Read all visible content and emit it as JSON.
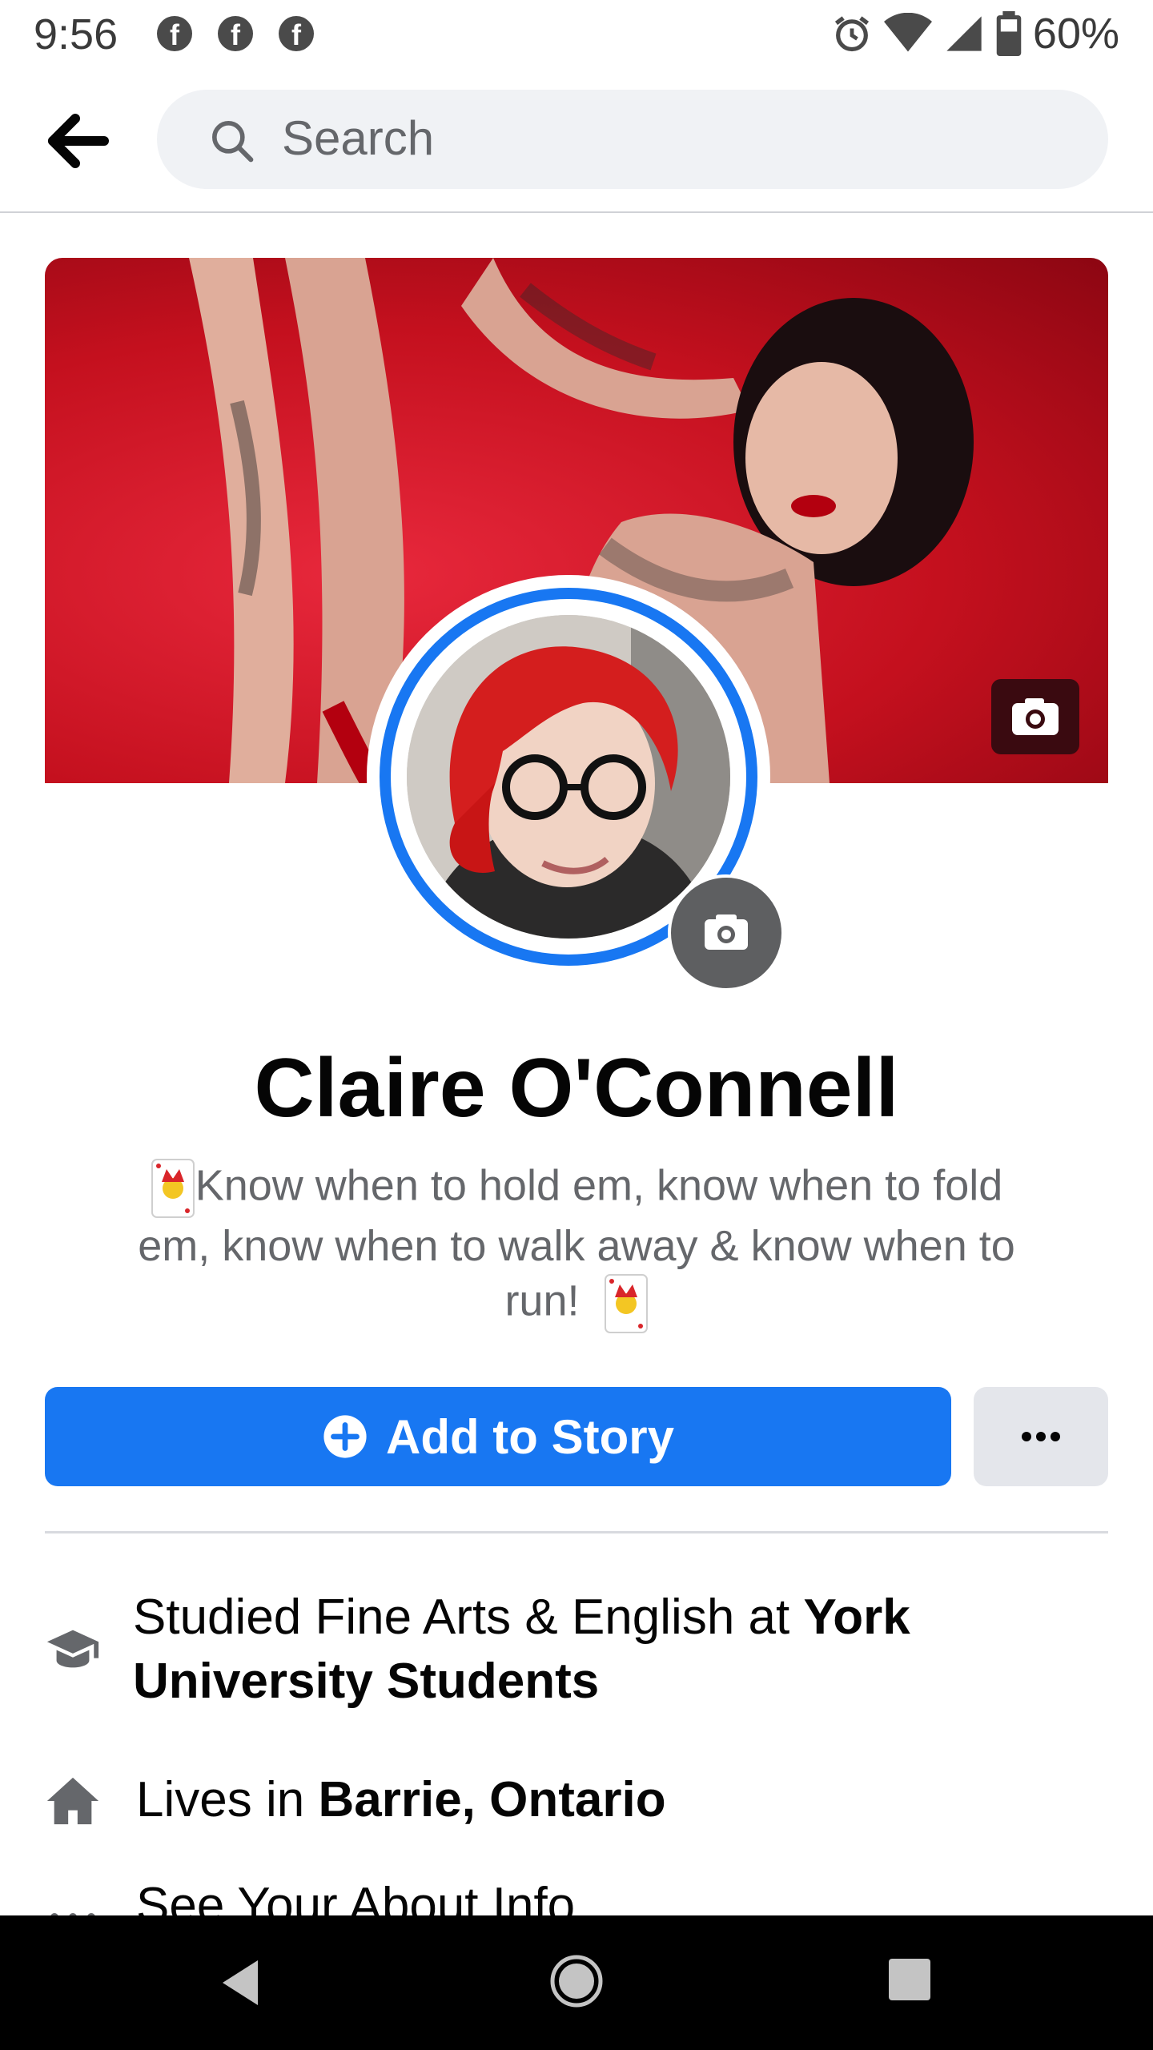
{
  "status_bar": {
    "time": "9:56",
    "notification_icons": [
      "facebook-icon",
      "facebook-icon",
      "facebook-icon"
    ],
    "battery_percent": "60%",
    "icons": [
      "alarm-icon",
      "wifi-icon",
      "signal-icon",
      "battery-icon"
    ]
  },
  "top_bar": {
    "search_placeholder": "Search",
    "back_icon": "back-arrow-icon",
    "search_icon": "search-icon"
  },
  "profile": {
    "name": "Claire O'Connell",
    "bio_line1": "Know when to hold em,  know when to fold",
    "bio_line2": "em,  know when to walk away & know when to",
    "bio_line3": "run!",
    "bio_emoji": "joker-card-icon"
  },
  "actions": {
    "add_story_label": "Add to Story",
    "more_label": "..."
  },
  "info": {
    "education_prefix": "Studied Fine Arts & English at ",
    "education_place_line1": "York",
    "education_place_line2": "University Students",
    "lives_prefix": "Lives in ",
    "lives_place": "Barrie, Ontario",
    "about_label": "See Your About Info"
  },
  "colors": {
    "accent": "#1877f2",
    "secondary_text": "#65676b",
    "button_grey": "#e4e6eb"
  }
}
